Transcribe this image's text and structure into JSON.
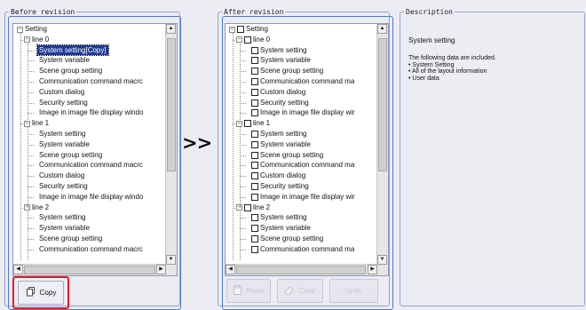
{
  "before": {
    "title": "Before revision",
    "rows": [
      {
        "label": "Setting",
        "depth": 0,
        "expander": "−"
      },
      {
        "label": "line 0",
        "depth": 1,
        "expander": "−"
      },
      {
        "label": "System setting[Copy]",
        "depth": 2,
        "selected": true
      },
      {
        "label": "System variable",
        "depth": 2
      },
      {
        "label": "Scene group setting",
        "depth": 2
      },
      {
        "label": "Communication command macrc",
        "depth": 2
      },
      {
        "label": "Custom dialog",
        "depth": 2
      },
      {
        "label": "Security setting",
        "depth": 2
      },
      {
        "label": "Image in image file display windo",
        "depth": 2
      },
      {
        "label": "line 1",
        "depth": 1,
        "expander": "−"
      },
      {
        "label": "System setting",
        "depth": 2
      },
      {
        "label": "System variable",
        "depth": 2
      },
      {
        "label": "Scene group setting",
        "depth": 2
      },
      {
        "label": "Communication command macrc",
        "depth": 2
      },
      {
        "label": "Custom dialog",
        "depth": 2
      },
      {
        "label": "Security setting",
        "depth": 2
      },
      {
        "label": "Image in image file display windo",
        "depth": 2
      },
      {
        "label": "line 2",
        "depth": 1,
        "expander": "−"
      },
      {
        "label": "System setting",
        "depth": 2
      },
      {
        "label": "System variable",
        "depth": 2
      },
      {
        "label": "Scene group setting",
        "depth": 2
      },
      {
        "label": "Communication command macrc",
        "depth": 2
      }
    ],
    "copy_button": "Copy"
  },
  "transfer_arrow": ">>",
  "after": {
    "title": "After revision",
    "rows": [
      {
        "label": "Setting",
        "depth": 0,
        "expander": "−"
      },
      {
        "label": "line 0",
        "depth": 1,
        "expander": "−"
      },
      {
        "label": "System setting",
        "depth": 2
      },
      {
        "label": "System variable",
        "depth": 2
      },
      {
        "label": "Scene group setting",
        "depth": 2
      },
      {
        "label": "Communication command ma",
        "depth": 2
      },
      {
        "label": "Custom dialog",
        "depth": 2
      },
      {
        "label": "Security setting",
        "depth": 2
      },
      {
        "label": "Image in image file display wir",
        "depth": 2
      },
      {
        "label": "line 1",
        "depth": 1,
        "expander": "−"
      },
      {
        "label": "System setting",
        "depth": 2
      },
      {
        "label": "System variable",
        "depth": 2
      },
      {
        "label": "Scene group setting",
        "depth": 2
      },
      {
        "label": "Communication command ma",
        "depth": 2
      },
      {
        "label": "Custom dialog",
        "depth": 2
      },
      {
        "label": "Security setting",
        "depth": 2
      },
      {
        "label": "Image in image file display wir",
        "depth": 2
      },
      {
        "label": "line 2",
        "depth": 1,
        "expander": "−"
      },
      {
        "label": "System setting",
        "depth": 2
      },
      {
        "label": "System variable",
        "depth": 2
      },
      {
        "label": "Scene group setting",
        "depth": 2
      },
      {
        "label": "Communication command ma",
        "depth": 2
      }
    ],
    "buttons": [
      "Paste",
      "Clear",
      "Undo"
    ]
  },
  "description": {
    "title": "Description",
    "heading": "System setting",
    "lines": [
      "The following data are included.",
      "• System Setting",
      "• All of the layout information",
      "• User data"
    ]
  },
  "icons": {
    "expander": "tree-expander-icon",
    "checkbox": "checkbox-icon",
    "copy": "copy-icon",
    "paste": "paste-icon",
    "clear": "eraser-icon",
    "undo": "undo-icon"
  },
  "colors": {
    "selection": "#1c3a96",
    "frame_border": "#4a78d0",
    "highlight": "#e0202a"
  }
}
